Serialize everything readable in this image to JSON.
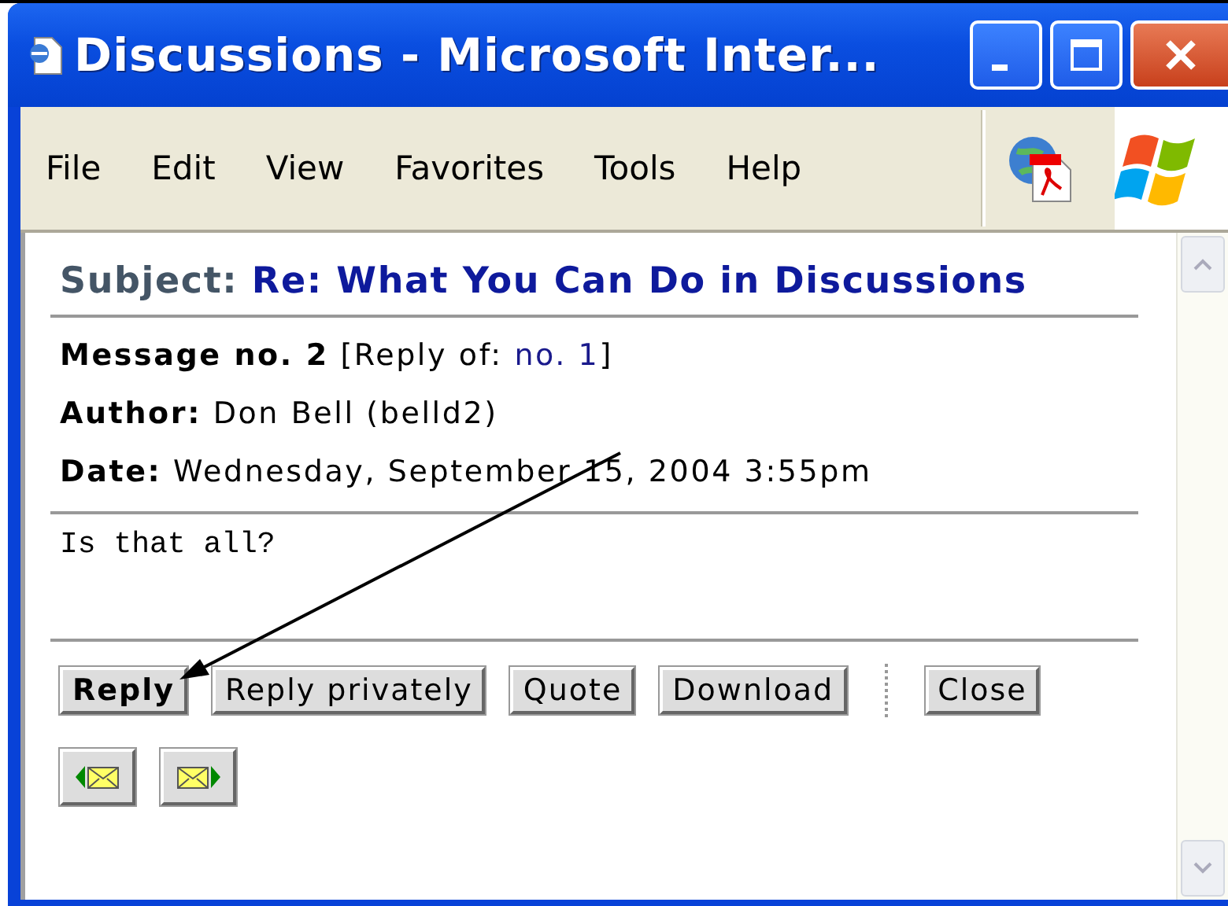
{
  "window": {
    "title": "Discussions - Microsoft Inter..."
  },
  "menu": [
    {
      "label": "File"
    },
    {
      "label": "Edit"
    },
    {
      "label": "View"
    },
    {
      "label": "Favorites"
    },
    {
      "label": "Tools"
    },
    {
      "label": "Help"
    }
  ],
  "message": {
    "subject_label": "Subject:",
    "subject": "Re: What You Can Do in Discussions",
    "number_label": "Message no. 2",
    "reply_of_label": "[Reply of:",
    "reply_of_link": "no. 1",
    "reply_of_end": "]",
    "author_label": "Author:",
    "author": "Don Bell (belld2)",
    "date_label": "Date:",
    "date": "Wednesday, September 15, 2004 3:55pm",
    "body": "Is that all?"
  },
  "buttons": [
    {
      "label": "Reply",
      "default": true,
      "kind": "text"
    },
    {
      "label": "Reply privately",
      "default": false,
      "kind": "text"
    },
    {
      "label": "Quote",
      "default": false,
      "kind": "text"
    },
    {
      "label": "Download",
      "default": false,
      "kind": "text"
    },
    {
      "kind": "separator"
    },
    {
      "label": "Close",
      "default": false,
      "kind": "text"
    }
  ],
  "nav_buttons": [
    {
      "kind": "previous"
    },
    {
      "kind": "next"
    }
  ]
}
